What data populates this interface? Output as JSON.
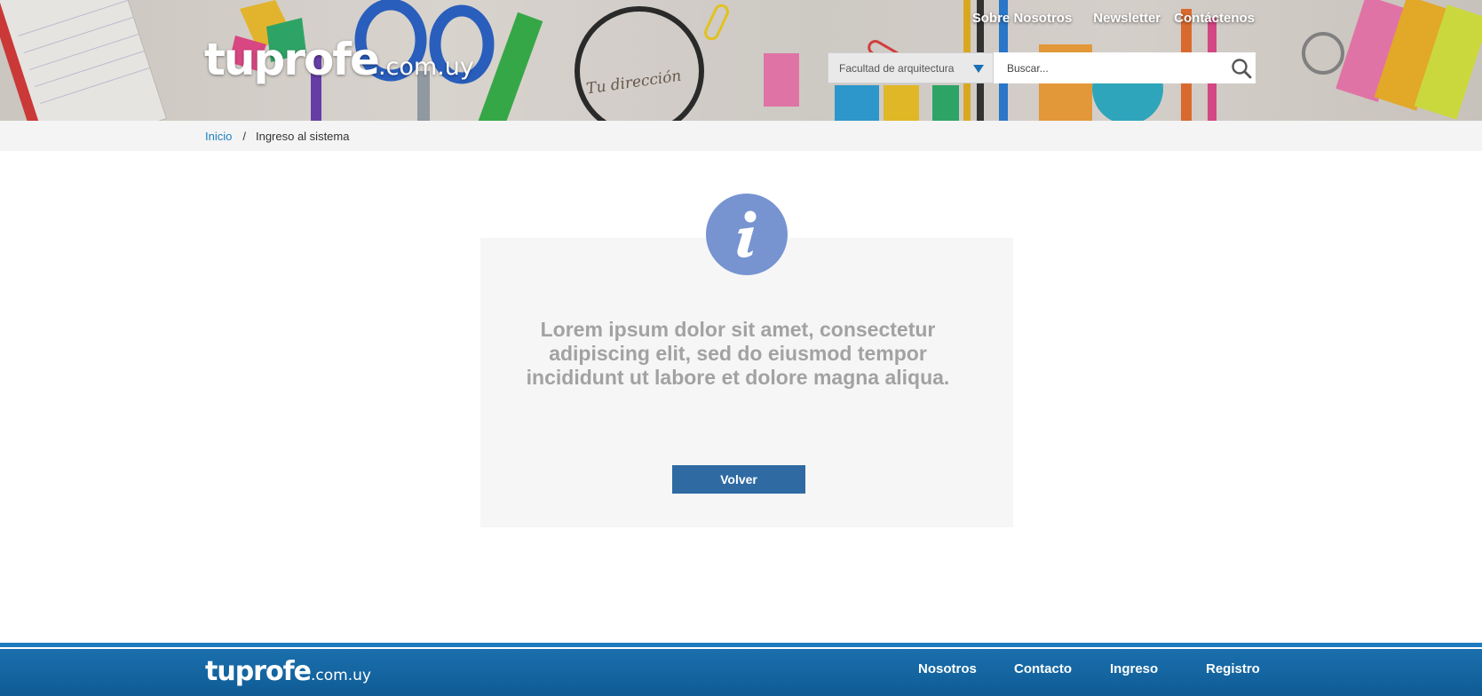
{
  "header": {
    "logo_main": "tuprofe",
    "logo_tld": ".com.uy",
    "banner_text": "Tu dirección",
    "nav": [
      "Sobre Nosotros",
      "Newsletter",
      "Contáctenos"
    ],
    "faculty_select": "Facultad de arquitectura",
    "search_placeholder": "Buscar..."
  },
  "breadcrumb": {
    "home": "Inicio",
    "separator": "/",
    "current": "Ingreso al sistema"
  },
  "panel": {
    "icon": "info-icon",
    "message": "Lorem ipsum dolor sit amet, consectetur adipiscing elit, sed do eiusmod tempor incididunt ut labore et dolore magna aliqua.",
    "button": "Volver"
  },
  "footer": {
    "logo_main": "tuprofe",
    "logo_tld": ".com.uy",
    "nav": [
      "Nosotros",
      "Contacto",
      "Ingreso",
      "Registro"
    ]
  },
  "colors": {
    "accent": "#1f7fbf",
    "button": "#2f6aa3",
    "info_icon": "#7794d1",
    "footer": "#0f5b95"
  }
}
